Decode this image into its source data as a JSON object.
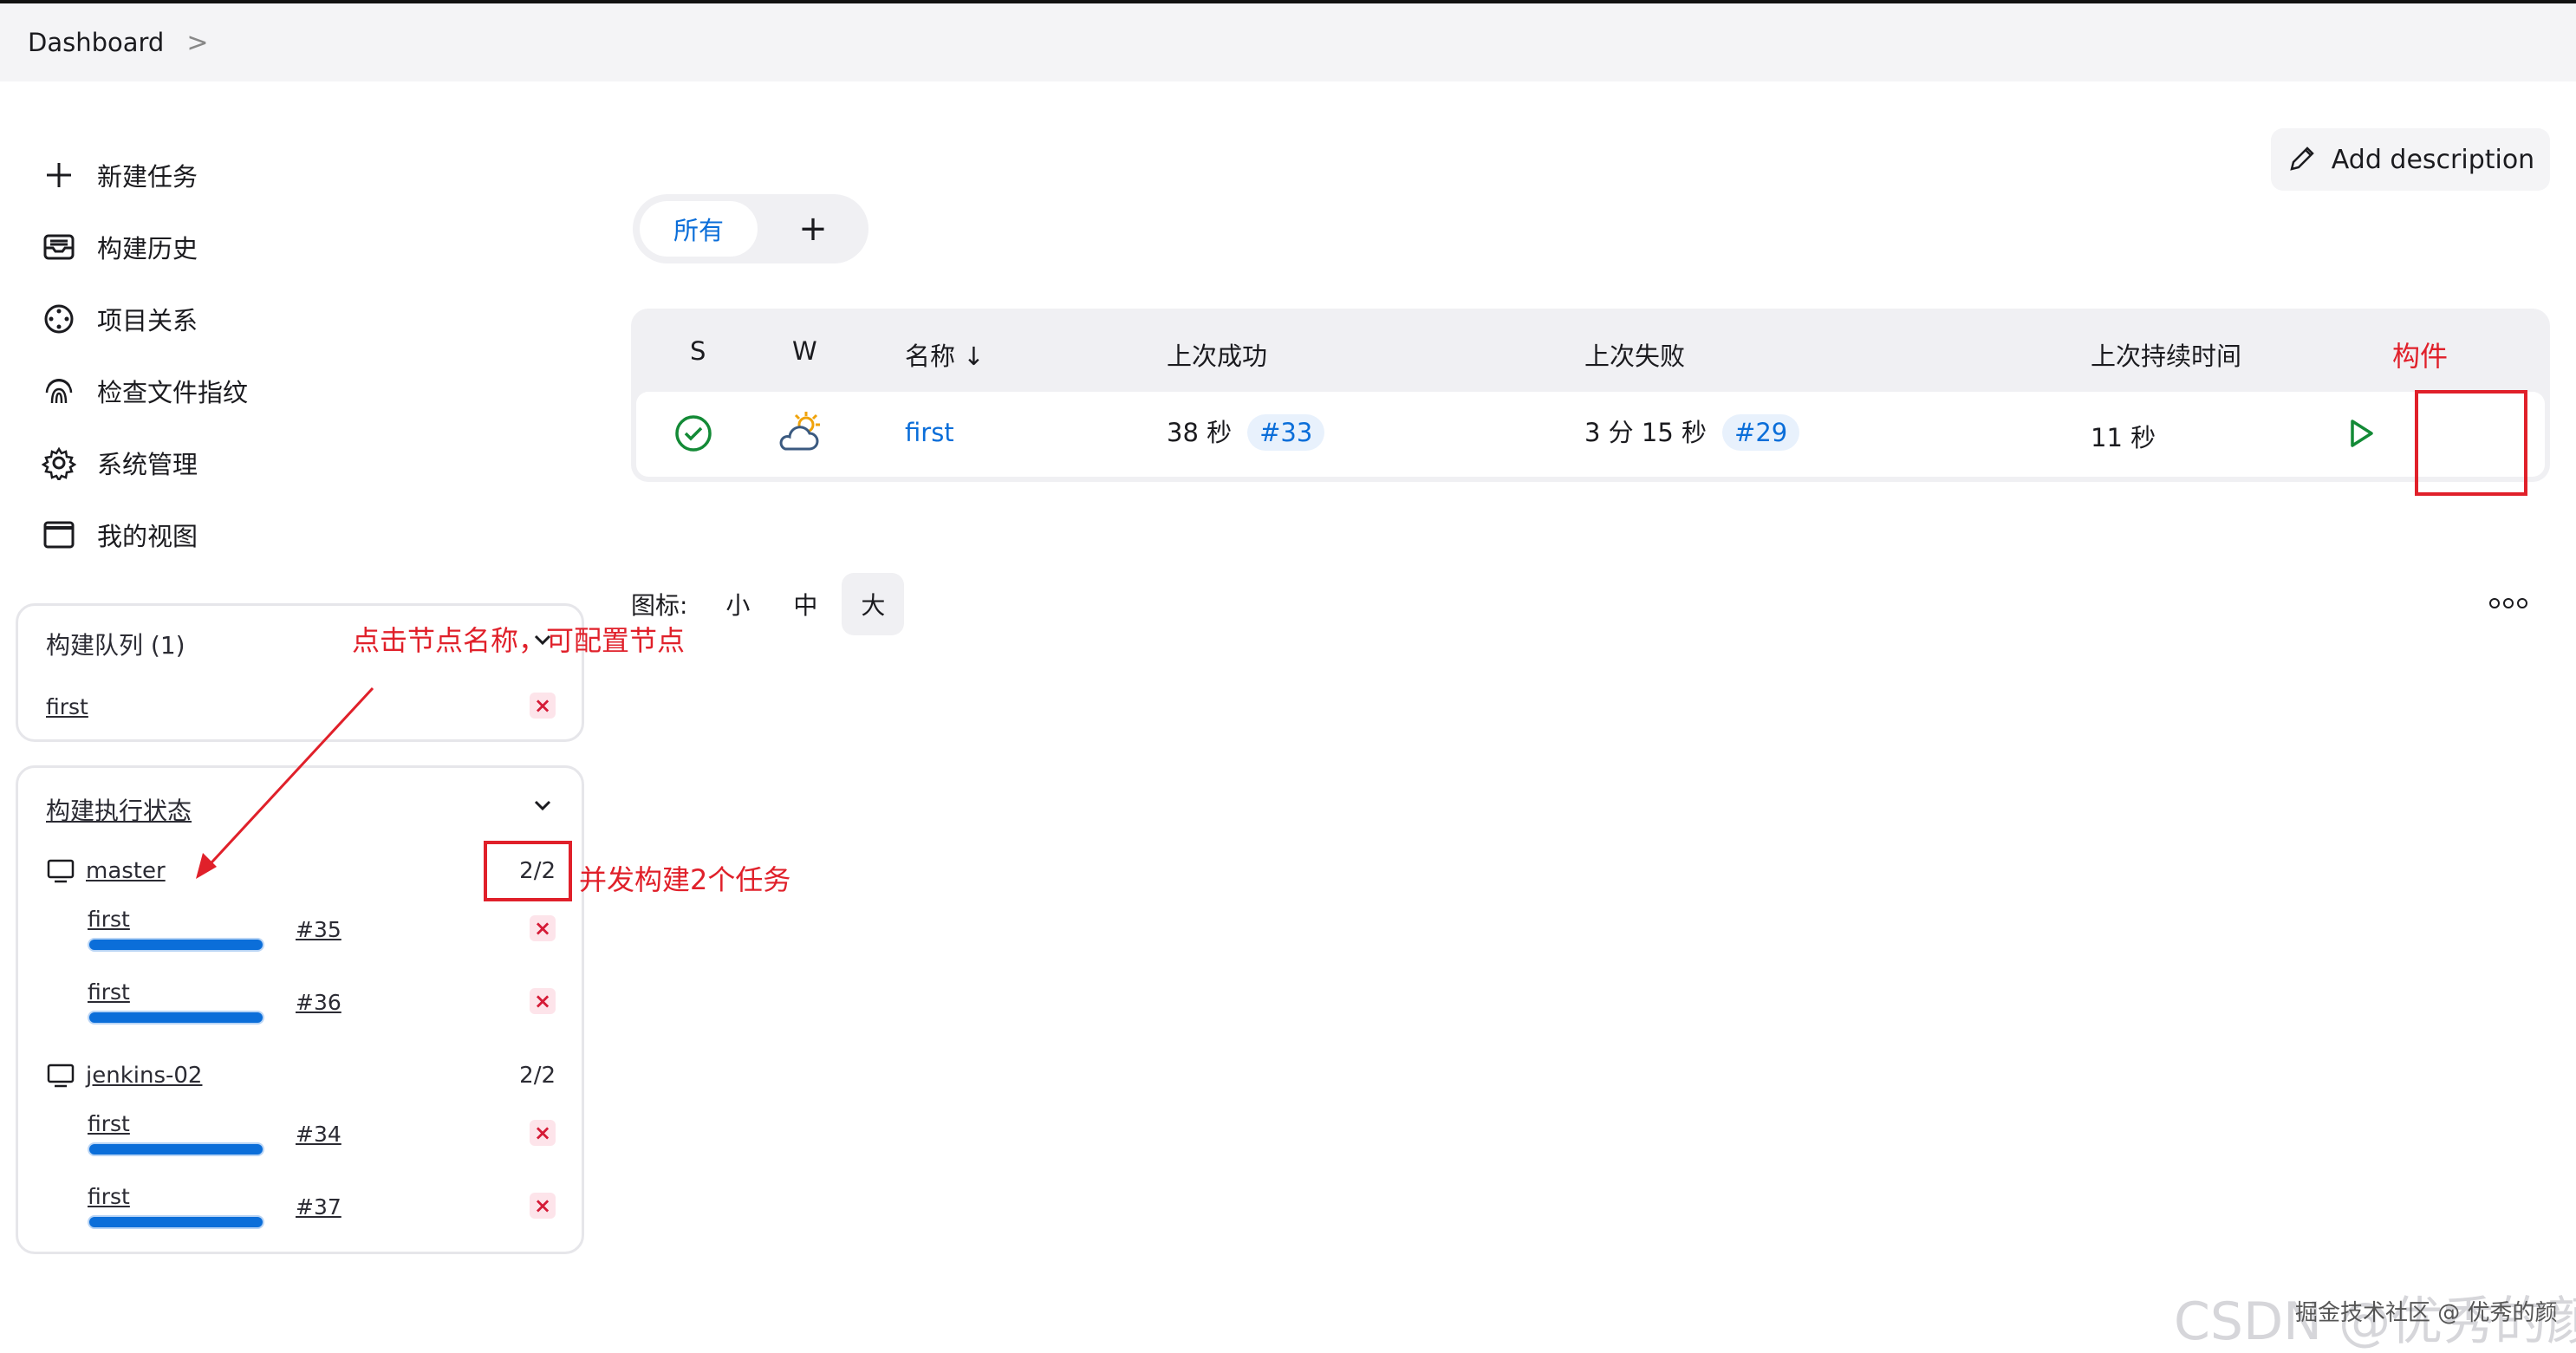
{
  "breadcrumb": {
    "dashboard": "Dashboard",
    "separator": ">"
  },
  "tasks": [
    {
      "label": "新建任务",
      "icon": "plus-icon"
    },
    {
      "label": "构建历史",
      "icon": "inbox-icon"
    },
    {
      "label": "项目关系",
      "icon": "relationship-icon"
    },
    {
      "label": "检查文件指纹",
      "icon": "fingerprint-icon"
    },
    {
      "label": "系统管理",
      "icon": "gear-icon"
    },
    {
      "label": "我的视图",
      "icon": "window-icon"
    }
  ],
  "queue": {
    "title": "构建队列 (1)",
    "items": [
      {
        "name": "first"
      }
    ]
  },
  "executors": {
    "title": "构建执行状态",
    "nodes": [
      {
        "name": "master",
        "count": "2/2",
        "builds": [
          {
            "job": "first",
            "num": "#35"
          },
          {
            "job": "first",
            "num": "#36"
          }
        ]
      },
      {
        "name": "jenkins-02",
        "count": "2/2",
        "builds": [
          {
            "job": "first",
            "num": "#34"
          },
          {
            "job": "first",
            "num": "#37"
          }
        ]
      }
    ]
  },
  "main": {
    "add_description": "Add description",
    "tabs": {
      "all": "所有",
      "add": "+"
    },
    "table": {
      "headers": {
        "s": "S",
        "w": "W",
        "name": "名称 ↓",
        "last_success": "上次成功",
        "last_failure": "上次失败",
        "last_duration": "上次持续时间"
      },
      "rows": [
        {
          "name": "first",
          "last_success_time": "38 秒",
          "last_success_build": "#33",
          "last_failure_time": "3 分 15 秒",
          "last_failure_build": "#29",
          "duration": "11 秒"
        }
      ]
    },
    "icon_size": {
      "label": "图标:",
      "small": "小",
      "medium": "中",
      "large": "大",
      "selected": "大"
    }
  },
  "annotations": {
    "build": "构件",
    "configure_node": "点击节点名称，可配置节点",
    "concurrent": "并发构建2个任务"
  },
  "watermark": {
    "big": "CSDN @优秀的颜",
    "small": "掘金技术社区 @ 优秀的颜"
  },
  "colors": {
    "accent": "#0b6ed9",
    "success": "#138a36",
    "annotation": "#e0202a",
    "danger": "#d51b37"
  }
}
